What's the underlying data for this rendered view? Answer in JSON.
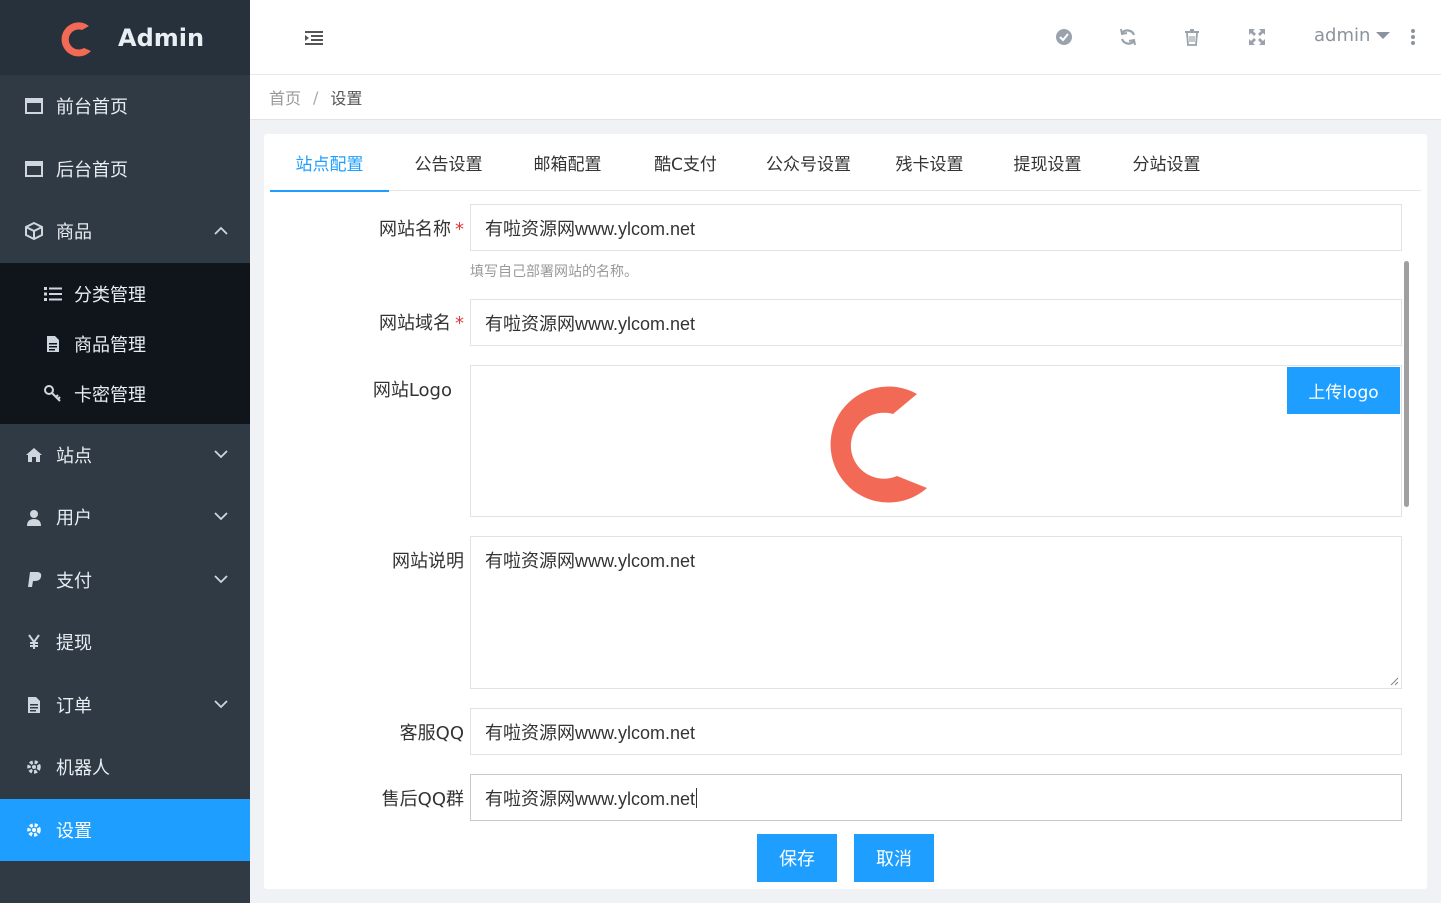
{
  "sidebar": {
    "brand": "Admin",
    "items": [
      {
        "label": "前台首页",
        "icon": "window-icon"
      },
      {
        "label": "后台首页",
        "icon": "window-icon"
      },
      {
        "label": "商品",
        "icon": "cube-icon"
      },
      {
        "label": "站点",
        "icon": "home-icon"
      },
      {
        "label": "用户",
        "icon": "user-icon"
      },
      {
        "label": "支付",
        "icon": "paypal-icon"
      },
      {
        "label": "提现",
        "icon": "yen-icon"
      },
      {
        "label": "订单",
        "icon": "file-icon"
      },
      {
        "label": "机器人",
        "icon": "gear-icon"
      },
      {
        "label": "设置",
        "icon": "gear-icon"
      }
    ],
    "submenu": [
      {
        "label": "分类管理",
        "icon": "list-icon"
      },
      {
        "label": "商品管理",
        "icon": "file-icon"
      },
      {
        "label": "卡密管理",
        "icon": "key-icon"
      }
    ]
  },
  "header": {
    "user": "admin"
  },
  "breadcrumb": {
    "home": "首页",
    "sep": "/",
    "current": "设置"
  },
  "tabs": [
    {
      "label": "站点配置"
    },
    {
      "label": "公告设置"
    },
    {
      "label": "邮箱配置"
    },
    {
      "label": "酷C支付"
    },
    {
      "label": "公众号设置"
    },
    {
      "label": "残卡设置"
    },
    {
      "label": "提现设置"
    },
    {
      "label": "分站设置"
    }
  ],
  "form": {
    "site_name_label": "网站名称",
    "site_name_value": "有啦资源网www.ylcom.net",
    "site_name_hint": "填写自己部署网站的名称。",
    "domain_label": "网站域名",
    "domain_value": "有啦资源网www.ylcom.net",
    "logo_label": "网站Logo",
    "upload_label": "上传logo",
    "desc_label": "网站说明",
    "desc_value": "有啦资源网www.ylcom.net",
    "qq_label": "客服QQ",
    "qq_value": "有啦资源网www.ylcom.net",
    "group_label": "售后QQ群",
    "group_value": "有啦资源网www.ylcom.net",
    "required_mark": "*",
    "save_label": "保存",
    "cancel_label": "取消"
  },
  "colors": {
    "accent": "#1e9fff",
    "sidebar": "#2f3a45",
    "logo_red": "#f26a55"
  }
}
